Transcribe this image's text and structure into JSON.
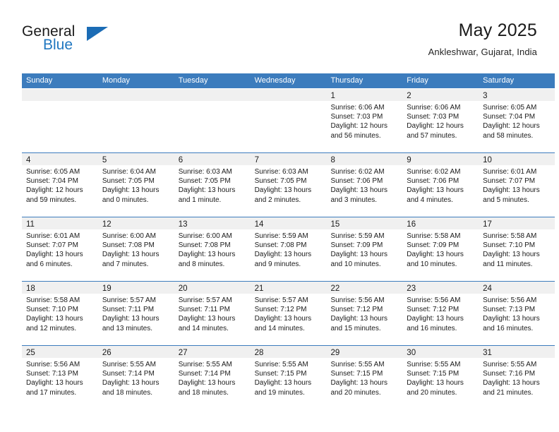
{
  "brand": {
    "name_line1": "General",
    "name_line2": "Blue",
    "accent_color": "#2077c0",
    "triangle_color": "#1b6cb5"
  },
  "header": {
    "title": "May 2025",
    "subtitle": "Ankleshwar, Gujarat, India"
  },
  "theme": {
    "header_blue": "#3c7cbd",
    "day_band_gray": "#f0f0f0",
    "text_color": "#1a1a1a"
  },
  "weekdays": [
    "Sunday",
    "Monday",
    "Tuesday",
    "Wednesday",
    "Thursday",
    "Friday",
    "Saturday"
  ],
  "weeks": [
    [
      {
        "day": "",
        "sunrise": "",
        "sunset": "",
        "daylight_line1": "",
        "daylight_line2": ""
      },
      {
        "day": "",
        "sunrise": "",
        "sunset": "",
        "daylight_line1": "",
        "daylight_line2": ""
      },
      {
        "day": "",
        "sunrise": "",
        "sunset": "",
        "daylight_line1": "",
        "daylight_line2": ""
      },
      {
        "day": "",
        "sunrise": "",
        "sunset": "",
        "daylight_line1": "",
        "daylight_line2": ""
      },
      {
        "day": "1",
        "sunrise": "Sunrise: 6:06 AM",
        "sunset": "Sunset: 7:03 PM",
        "daylight_line1": "Daylight: 12 hours",
        "daylight_line2": "and 56 minutes."
      },
      {
        "day": "2",
        "sunrise": "Sunrise: 6:06 AM",
        "sunset": "Sunset: 7:03 PM",
        "daylight_line1": "Daylight: 12 hours",
        "daylight_line2": "and 57 minutes."
      },
      {
        "day": "3",
        "sunrise": "Sunrise: 6:05 AM",
        "sunset": "Sunset: 7:04 PM",
        "daylight_line1": "Daylight: 12 hours",
        "daylight_line2": "and 58 minutes."
      }
    ],
    [
      {
        "day": "4",
        "sunrise": "Sunrise: 6:05 AM",
        "sunset": "Sunset: 7:04 PM",
        "daylight_line1": "Daylight: 12 hours",
        "daylight_line2": "and 59 minutes."
      },
      {
        "day": "5",
        "sunrise": "Sunrise: 6:04 AM",
        "sunset": "Sunset: 7:05 PM",
        "daylight_line1": "Daylight: 13 hours",
        "daylight_line2": "and 0 minutes."
      },
      {
        "day": "6",
        "sunrise": "Sunrise: 6:03 AM",
        "sunset": "Sunset: 7:05 PM",
        "daylight_line1": "Daylight: 13 hours",
        "daylight_line2": "and 1 minute."
      },
      {
        "day": "7",
        "sunrise": "Sunrise: 6:03 AM",
        "sunset": "Sunset: 7:05 PM",
        "daylight_line1": "Daylight: 13 hours",
        "daylight_line2": "and 2 minutes."
      },
      {
        "day": "8",
        "sunrise": "Sunrise: 6:02 AM",
        "sunset": "Sunset: 7:06 PM",
        "daylight_line1": "Daylight: 13 hours",
        "daylight_line2": "and 3 minutes."
      },
      {
        "day": "9",
        "sunrise": "Sunrise: 6:02 AM",
        "sunset": "Sunset: 7:06 PM",
        "daylight_line1": "Daylight: 13 hours",
        "daylight_line2": "and 4 minutes."
      },
      {
        "day": "10",
        "sunrise": "Sunrise: 6:01 AM",
        "sunset": "Sunset: 7:07 PM",
        "daylight_line1": "Daylight: 13 hours",
        "daylight_line2": "and 5 minutes."
      }
    ],
    [
      {
        "day": "11",
        "sunrise": "Sunrise: 6:01 AM",
        "sunset": "Sunset: 7:07 PM",
        "daylight_line1": "Daylight: 13 hours",
        "daylight_line2": "and 6 minutes."
      },
      {
        "day": "12",
        "sunrise": "Sunrise: 6:00 AM",
        "sunset": "Sunset: 7:08 PM",
        "daylight_line1": "Daylight: 13 hours",
        "daylight_line2": "and 7 minutes."
      },
      {
        "day": "13",
        "sunrise": "Sunrise: 6:00 AM",
        "sunset": "Sunset: 7:08 PM",
        "daylight_line1": "Daylight: 13 hours",
        "daylight_line2": "and 8 minutes."
      },
      {
        "day": "14",
        "sunrise": "Sunrise: 5:59 AM",
        "sunset": "Sunset: 7:08 PM",
        "daylight_line1": "Daylight: 13 hours",
        "daylight_line2": "and 9 minutes."
      },
      {
        "day": "15",
        "sunrise": "Sunrise: 5:59 AM",
        "sunset": "Sunset: 7:09 PM",
        "daylight_line1": "Daylight: 13 hours",
        "daylight_line2": "and 10 minutes."
      },
      {
        "day": "16",
        "sunrise": "Sunrise: 5:58 AM",
        "sunset": "Sunset: 7:09 PM",
        "daylight_line1": "Daylight: 13 hours",
        "daylight_line2": "and 10 minutes."
      },
      {
        "day": "17",
        "sunrise": "Sunrise: 5:58 AM",
        "sunset": "Sunset: 7:10 PM",
        "daylight_line1": "Daylight: 13 hours",
        "daylight_line2": "and 11 minutes."
      }
    ],
    [
      {
        "day": "18",
        "sunrise": "Sunrise: 5:58 AM",
        "sunset": "Sunset: 7:10 PM",
        "daylight_line1": "Daylight: 13 hours",
        "daylight_line2": "and 12 minutes."
      },
      {
        "day": "19",
        "sunrise": "Sunrise: 5:57 AM",
        "sunset": "Sunset: 7:11 PM",
        "daylight_line1": "Daylight: 13 hours",
        "daylight_line2": "and 13 minutes."
      },
      {
        "day": "20",
        "sunrise": "Sunrise: 5:57 AM",
        "sunset": "Sunset: 7:11 PM",
        "daylight_line1": "Daylight: 13 hours",
        "daylight_line2": "and 14 minutes."
      },
      {
        "day": "21",
        "sunrise": "Sunrise: 5:57 AM",
        "sunset": "Sunset: 7:12 PM",
        "daylight_line1": "Daylight: 13 hours",
        "daylight_line2": "and 14 minutes."
      },
      {
        "day": "22",
        "sunrise": "Sunrise: 5:56 AM",
        "sunset": "Sunset: 7:12 PM",
        "daylight_line1": "Daylight: 13 hours",
        "daylight_line2": "and 15 minutes."
      },
      {
        "day": "23",
        "sunrise": "Sunrise: 5:56 AM",
        "sunset": "Sunset: 7:12 PM",
        "daylight_line1": "Daylight: 13 hours",
        "daylight_line2": "and 16 minutes."
      },
      {
        "day": "24",
        "sunrise": "Sunrise: 5:56 AM",
        "sunset": "Sunset: 7:13 PM",
        "daylight_line1": "Daylight: 13 hours",
        "daylight_line2": "and 16 minutes."
      }
    ],
    [
      {
        "day": "25",
        "sunrise": "Sunrise: 5:56 AM",
        "sunset": "Sunset: 7:13 PM",
        "daylight_line1": "Daylight: 13 hours",
        "daylight_line2": "and 17 minutes."
      },
      {
        "day": "26",
        "sunrise": "Sunrise: 5:55 AM",
        "sunset": "Sunset: 7:14 PM",
        "daylight_line1": "Daylight: 13 hours",
        "daylight_line2": "and 18 minutes."
      },
      {
        "day": "27",
        "sunrise": "Sunrise: 5:55 AM",
        "sunset": "Sunset: 7:14 PM",
        "daylight_line1": "Daylight: 13 hours",
        "daylight_line2": "and 18 minutes."
      },
      {
        "day": "28",
        "sunrise": "Sunrise: 5:55 AM",
        "sunset": "Sunset: 7:15 PM",
        "daylight_line1": "Daylight: 13 hours",
        "daylight_line2": "and 19 minutes."
      },
      {
        "day": "29",
        "sunrise": "Sunrise: 5:55 AM",
        "sunset": "Sunset: 7:15 PM",
        "daylight_line1": "Daylight: 13 hours",
        "daylight_line2": "and 20 minutes."
      },
      {
        "day": "30",
        "sunrise": "Sunrise: 5:55 AM",
        "sunset": "Sunset: 7:15 PM",
        "daylight_line1": "Daylight: 13 hours",
        "daylight_line2": "and 20 minutes."
      },
      {
        "day": "31",
        "sunrise": "Sunrise: 5:55 AM",
        "sunset": "Sunset: 7:16 PM",
        "daylight_line1": "Daylight: 13 hours",
        "daylight_line2": "and 21 minutes."
      }
    ]
  ]
}
